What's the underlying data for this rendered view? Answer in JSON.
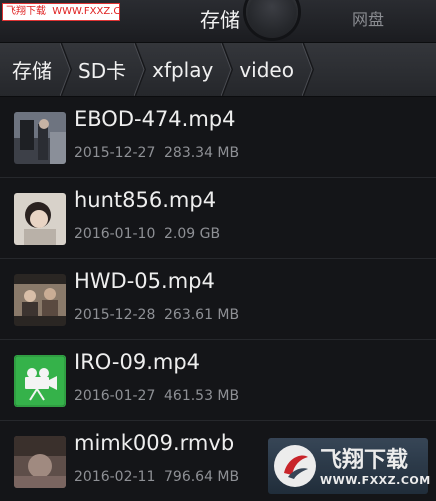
{
  "watermark": {
    "site_name": "飞翔下载",
    "url": "WWW.FXXZ.COM"
  },
  "tabs": {
    "left_label": "",
    "storage_label": "存储",
    "network_label": "网盘"
  },
  "breadcrumb": [
    "存储",
    "SD卡",
    "xfplay",
    "video"
  ],
  "files": [
    {
      "name": "EBOD-474.mp4",
      "date": "2015-12-27",
      "size": "283.34 MB",
      "thumb_color": "#5a5f68"
    },
    {
      "name": "hunt856.mp4",
      "date": "2016-01-10",
      "size": "2.09 GB",
      "thumb_color": "#c9c3bc"
    },
    {
      "name": "HWD-05.mp4",
      "date": "2015-12-28",
      "size": "263.61 MB",
      "thumb_color": "#7a6a5c"
    },
    {
      "name": "IRO-09.mp4",
      "date": "2016-01-27",
      "size": "461.53 MB",
      "thumb_color": "#3bb54a",
      "thumb_icon": "video-camera-icon"
    },
    {
      "name": "mimk009.rmvb",
      "date": "2016-02-11",
      "size": "796.64 MB",
      "thumb_color": "#6b5a55"
    }
  ],
  "logo": {
    "name": "飞翔下载",
    "url": "WWW.FXXZ.COM"
  }
}
